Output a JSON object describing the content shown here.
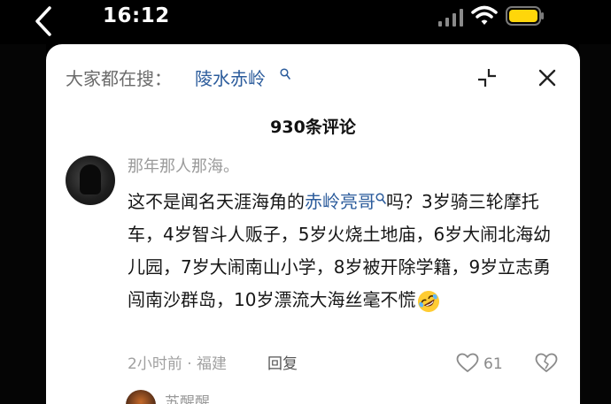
{
  "status_bar": {
    "time": "16:12"
  },
  "search_bar": {
    "label": "大家都在搜：",
    "term": "陵水赤岭"
  },
  "comments_header": {
    "count_label": "930条评论"
  },
  "comment": {
    "username": "那年那人那海。",
    "text_before_link": "这不是闻名天涯海角的",
    "link_text": "赤岭亮哥",
    "text_after_link": "吗？3岁骑三轮摩托车，4岁智斗人贩子，5岁火烧土地庙，6岁大闹北海幼儿园，7岁大闹南山小学，8岁被开除学籍，9岁立志勇闯南沙群岛，10岁漂流大海丝毫不慌",
    "emoji": "rolling-on-floor-laughing-emoji",
    "meta": "2小时前 · 福建",
    "reply_label": "回复",
    "like_count": "61"
  },
  "next_comment": {
    "username": "苏醒醒"
  },
  "colors": {
    "link": "#2c5c9c",
    "background": "#ffffff",
    "status_bar": "#000000",
    "battery": "#ffd60a"
  },
  "icons": [
    "back-icon",
    "signal-icon",
    "wifi-icon",
    "battery-icon",
    "search-icon",
    "collapse-icon",
    "close-icon",
    "heart-icon",
    "broken-heart-icon"
  ]
}
